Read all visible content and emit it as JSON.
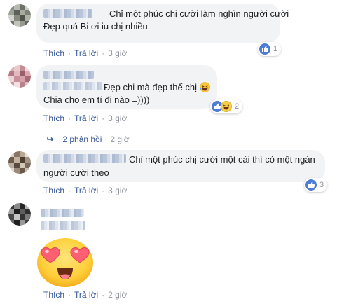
{
  "actions": {
    "like": "Thích",
    "reply": "Trả lời",
    "dot": "·"
  },
  "comments": [
    {
      "text_lines": [
        "Chỉ một phúc chị cười làm nghìn người cười",
        "Đẹp quá Bi ơi iu chị nhiều"
      ],
      "time": "3 giờ",
      "reaction": {
        "icon": "like-icon",
        "count": "1"
      }
    },
    {
      "text_lines": [
        "Đẹp chi mà đẹp thế chị",
        "Chia cho em tí đi nào =))))"
      ],
      "inline_emoji": "laughing-emoji-icon",
      "time": "3 giờ",
      "reaction": {
        "icons": [
          "like-icon",
          "haha-icon"
        ],
        "count": "2"
      },
      "replies": {
        "label": "2 phản hồi",
        "time": "2 giờ"
      }
    },
    {
      "text_lines": [
        "Chỉ một phúc chị cười một cái thì có một ngàn",
        "người cười theo"
      ],
      "time": "3 giờ",
      "reaction": {
        "icon": "like-icon",
        "count": "3"
      }
    },
    {
      "sticker": "heart-eyes-emoji-icon",
      "time": "2 giờ"
    }
  ],
  "colors": {
    "link": "#385898",
    "meta": "#90949c",
    "bubble": "#f2f3f5",
    "like": "#4d7bd6",
    "haha": "#f7ce4a"
  }
}
